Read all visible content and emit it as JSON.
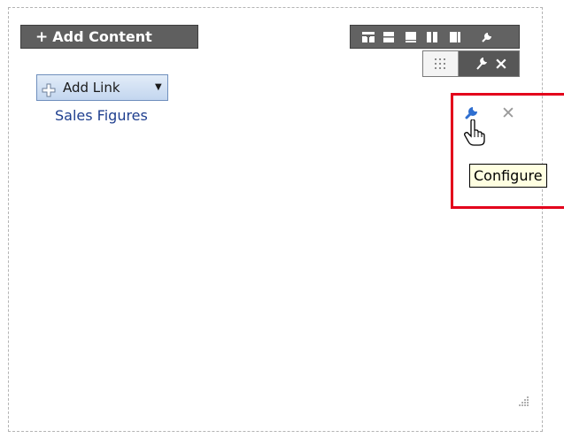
{
  "toolbar": {
    "add_content_label": "Add Content",
    "add_content_plus": "+"
  },
  "layout_icons": [
    "header-layout-icon",
    "one-row-icon",
    "two-rows-icon",
    "two-columns-icon",
    "column-split-icon",
    "wrench-icon"
  ],
  "sub_toolbar": {
    "close_glyph": "×"
  },
  "link_panel": {
    "add_link_label": "Add Link",
    "caret": "▼",
    "link_text": "Sales Figures"
  },
  "region_actions": {
    "delete_glyph": "✕",
    "tooltip": "Configure"
  },
  "colors": {
    "highlight": "#e3001b",
    "toolbar_bg": "#626262",
    "link": "#1f3f8f",
    "tooltip_bg": "#ffffe1"
  }
}
